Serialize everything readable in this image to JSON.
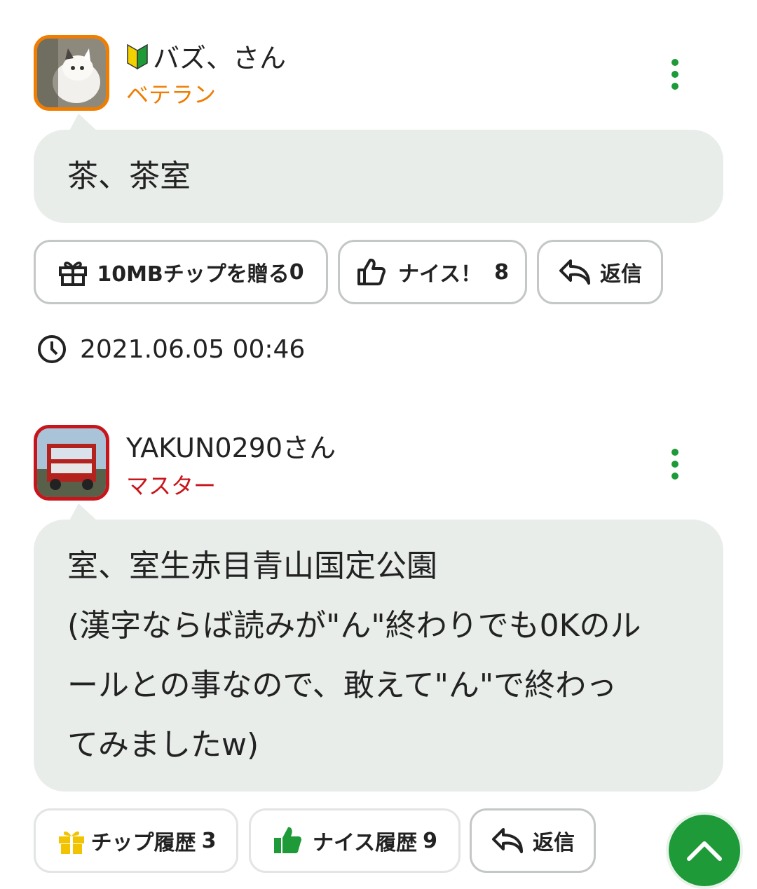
{
  "posts": [
    {
      "username": "バズ、さん",
      "badge_icon": "beginner-leaf-icon",
      "rank": "ベテラン",
      "rank_color": "#f07c00",
      "message_lines": [
        "茶、茶室"
      ],
      "actions": {
        "tip_label": "10MBチップを贈る",
        "tip_count": "0",
        "nice_label": "ナイス！",
        "nice_count": "8",
        "reply_label": "返信"
      },
      "timestamp": "2021.06.05 00:46"
    },
    {
      "username": "YAKUN0290さん",
      "rank": "マスター",
      "rank_color": "#c8151b",
      "message_lines": [
        "室、室生赤目青山国定公園",
        "(漢字ならば読みが\"ん\"終わりでも0Kのル",
        "ールとの事なので、敢えて\"ん\"で終わっ",
        "てみましたw)"
      ],
      "actions": {
        "tip_history_label": "チップ履歴",
        "tip_history_count": "3",
        "nice_history_label": "ナイス履歴",
        "nice_history_count": "9",
        "reply_label": "返信"
      }
    }
  ],
  "colors": {
    "accent_green": "#1e9a38",
    "bubble_bg": "#e9edea",
    "gift_yellow": "#f2c300"
  },
  "scroll_top_icon": "chevron-up-icon"
}
